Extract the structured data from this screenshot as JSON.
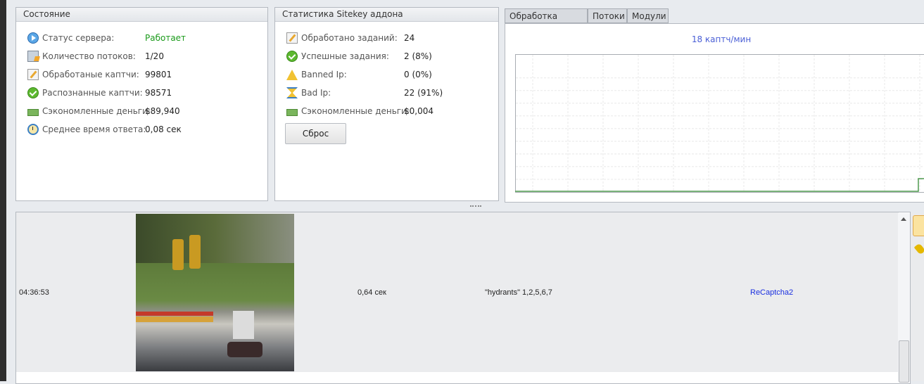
{
  "status_panel": {
    "title": "Состояние",
    "rows": [
      {
        "label": "Статус сервера:",
        "value": "Работает",
        "icon": "play-icon"
      },
      {
        "label": "Количество потоков:",
        "value": "1/20",
        "icon": "threads-icon"
      },
      {
        "label": "Обработаные каптчи:",
        "value": "99801",
        "icon": "edit-icon"
      },
      {
        "label": "Распознанные каптчи:",
        "value": "98571",
        "icon": "check-icon"
      },
      {
        "label": "Сэкономленные деньги:",
        "value": "$89,940",
        "icon": "money-icon"
      },
      {
        "label": "Среднее время ответа:",
        "value": "0,08 сек",
        "icon": "clock-icon"
      }
    ]
  },
  "sitekey_panel": {
    "title": "Статистика Sitekey аддона",
    "rows": [
      {
        "label": "Обработано заданий:",
        "value": "24",
        "icon": "edit-icon"
      },
      {
        "label": "Успешные задания:",
        "value": "2 (8%)",
        "icon": "check-icon"
      },
      {
        "label": "Banned Ip:",
        "value": "0 (0%)",
        "icon": "warning-icon"
      },
      {
        "label": "Bad Ip:",
        "value": "22 (91%)",
        "icon": "hourglass-icon"
      },
      {
        "label": "Сэкономленные деньги:",
        "value": "$0,004",
        "icon": "money-icon"
      }
    ],
    "reset_label": "Сброс"
  },
  "tabs": [
    "Обработка каптч",
    "Потоки",
    "Модули"
  ],
  "colors": {
    "running": "#1a9a1a",
    "rate": "#4a5fd6",
    "line": "#4e9a4e",
    "link": "#1a2fe0"
  },
  "chart_data": {
    "type": "line",
    "title": "18 каптч/мин",
    "xlabel": "",
    "ylabel": "",
    "ylim": [
      0,
      10
    ],
    "values": [
      0,
      0,
      0,
      0,
      0,
      0,
      0,
      0,
      0,
      0,
      0,
      0,
      0,
      0,
      0,
      0,
      0,
      0,
      0,
      0,
      0,
      0,
      0,
      0,
      0,
      0,
      0,
      0,
      0,
      0,
      0,
      0,
      0,
      0,
      0,
      0,
      0,
      0,
      0,
      0,
      0,
      0,
      0,
      0,
      0,
      0,
      0,
      0,
      0,
      0,
      0,
      0,
      0,
      0,
      0,
      0,
      0,
      1,
      1,
      2
    ]
  },
  "log": {
    "rows": [
      {
        "time": "04:36:53",
        "duration": "0,64 сек",
        "answer": "\"hydrants\" 1,2,5,6,7",
        "type": "ReCaptcha2"
      }
    ]
  }
}
